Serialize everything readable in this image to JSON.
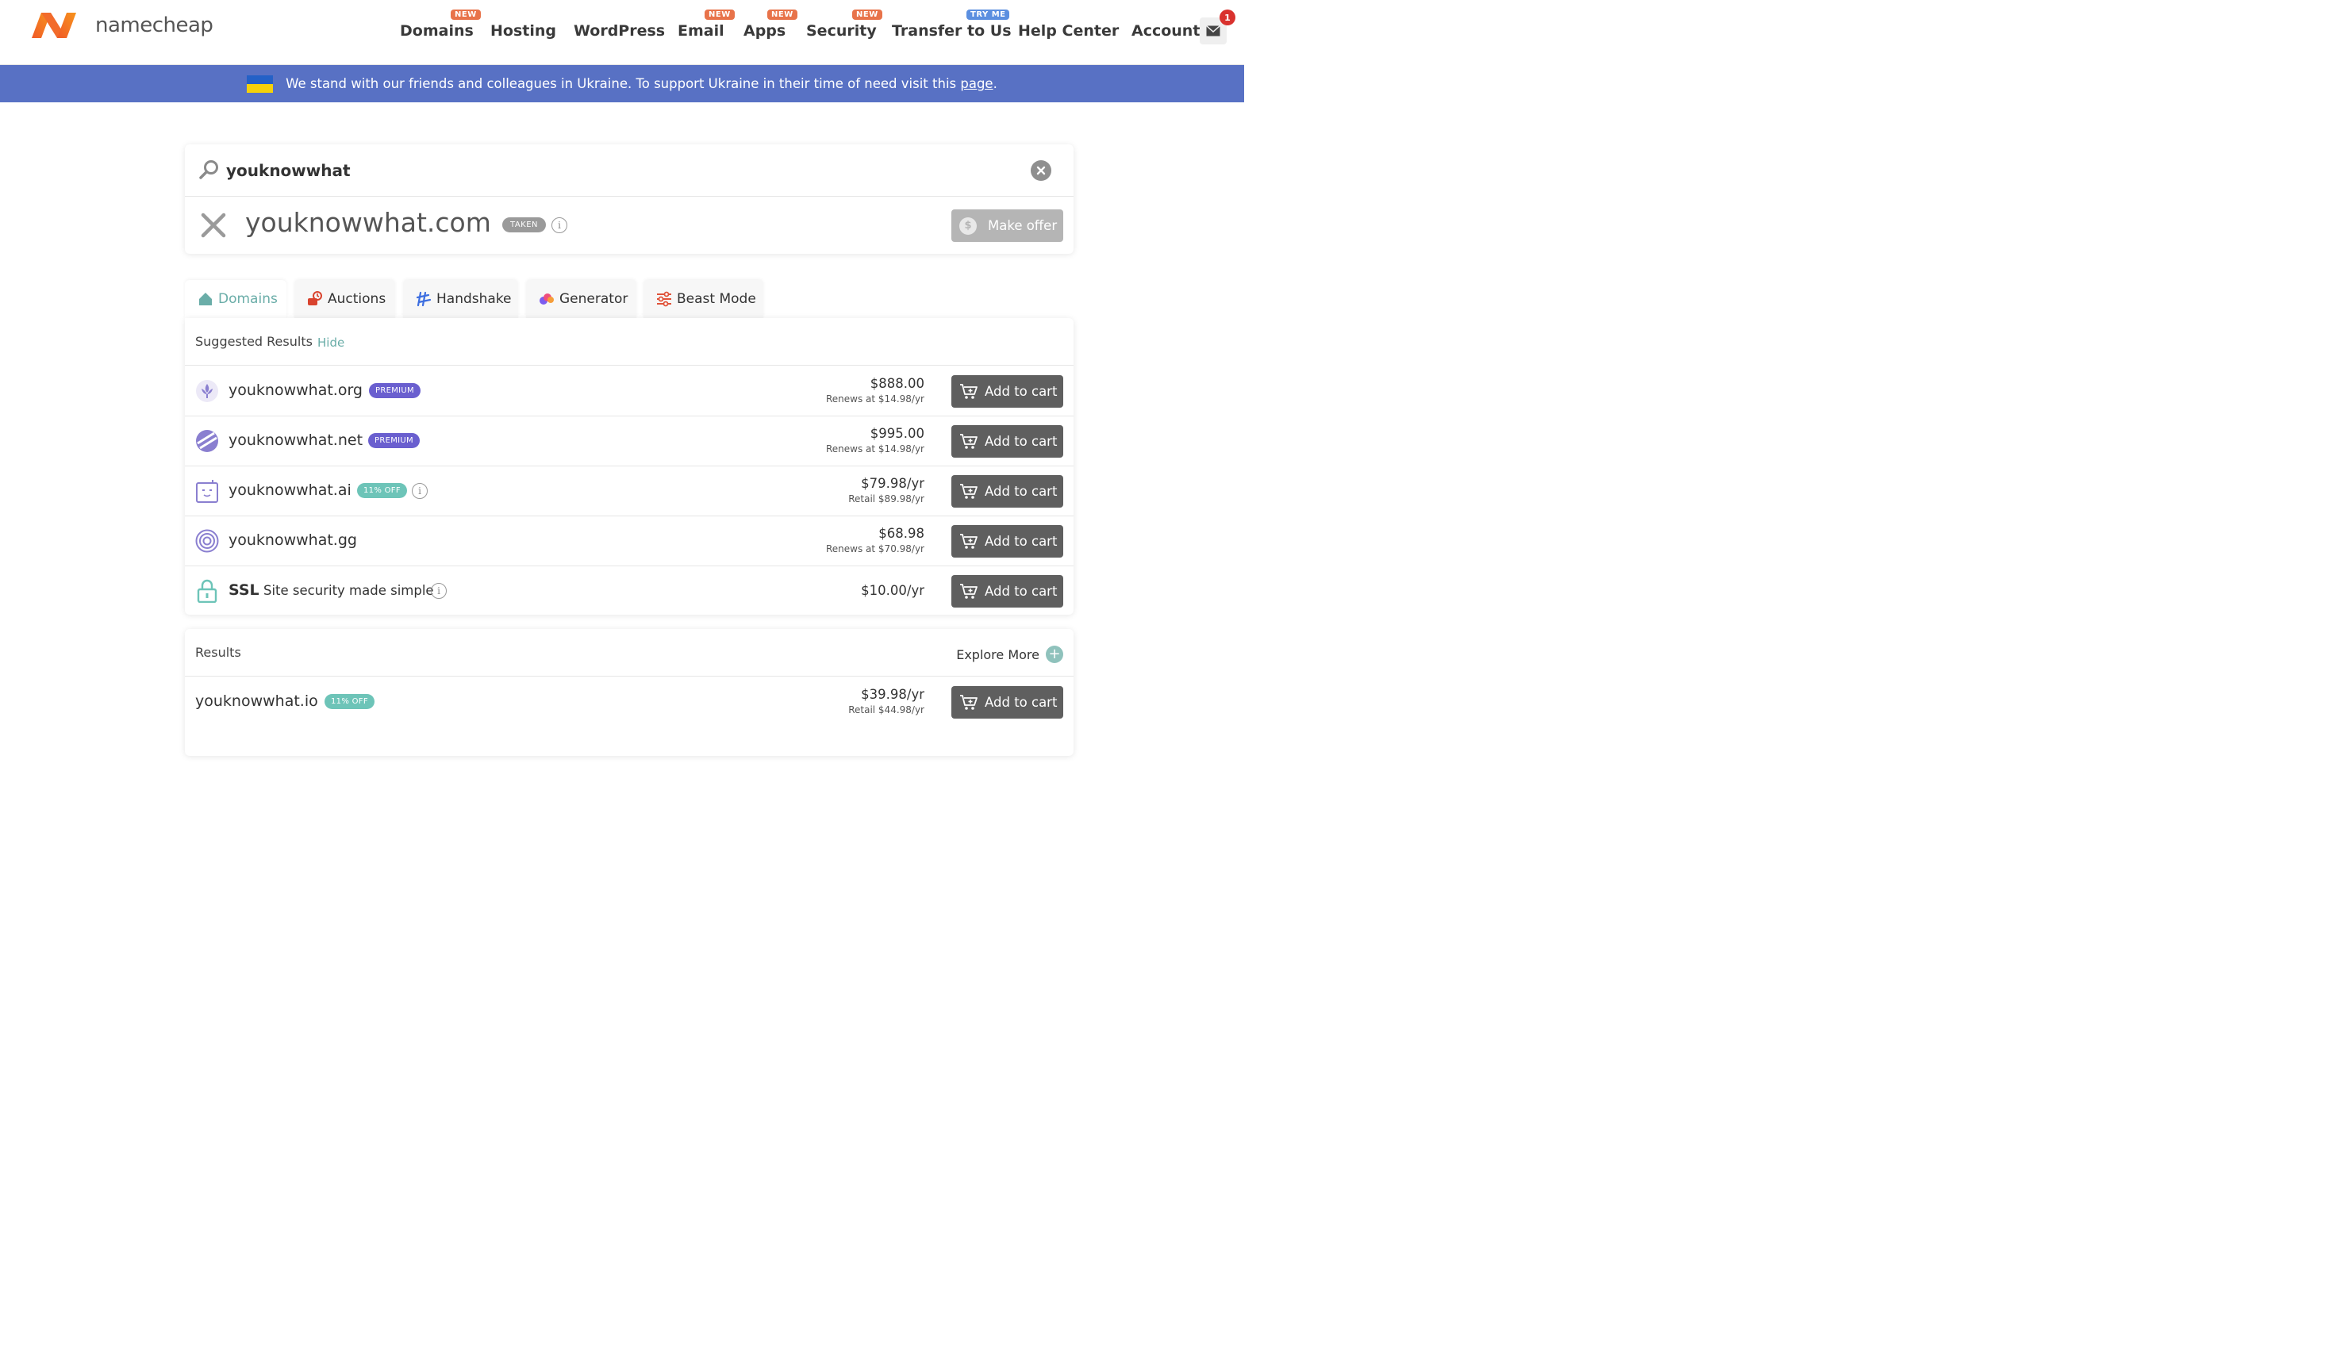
{
  "header": {
    "logo_text": "namecheap",
    "nav": [
      {
        "label": "Domains",
        "badge": "NEW"
      },
      {
        "label": "Hosting",
        "badge": ""
      },
      {
        "label": "WordPress",
        "badge": ""
      },
      {
        "label": "Email",
        "badge": "NEW"
      },
      {
        "label": "Apps",
        "badge": "NEW"
      },
      {
        "label": "Security",
        "badge": "NEW"
      },
      {
        "label": "Transfer to Us",
        "badge": "TRY ME"
      },
      {
        "label": "Help Center",
        "badge": ""
      },
      {
        "label": "Account",
        "badge": ""
      }
    ],
    "mail_count": "1",
    "brand_color": "#e8734a"
  },
  "banner": {
    "text": "We stand with our friends and colleagues in Ukraine. To support Ukraine in their time of need visit this ",
    "link": "page",
    "suffix": ".",
    "color": "#5871c4"
  },
  "search": {
    "value": "youknowwhat",
    "taken_domain": "youknowwhat.com",
    "taken_badge": "TAKEN",
    "offer_label": "Make offer",
    "offer_icon": "$"
  },
  "tabs": [
    {
      "label": "Domains",
      "icon": "home-icon",
      "active": true
    },
    {
      "label": "Auctions",
      "icon": "auction-icon",
      "active": false
    },
    {
      "label": "Handshake",
      "icon": "handshake-icon",
      "active": false
    },
    {
      "label": "Generator",
      "icon": "generator-icon",
      "active": false
    },
    {
      "label": "Beast Mode",
      "icon": "sliders-icon",
      "active": false
    }
  ],
  "suggested": {
    "title": "Suggested Results",
    "hide_label": "Hide",
    "rows": [
      {
        "domain": "youknowwhat.org",
        "badge": "PREMIUM",
        "price": "$888.00",
        "sub": "Renews at $14.98/yr",
        "cart": "Add to cart"
      },
      {
        "domain": "youknowwhat.net",
        "badge": "PREMIUM",
        "price": "$995.00",
        "sub": "Renews at $14.98/yr",
        "cart": "Add to cart"
      },
      {
        "domain": "youknowwhat.ai",
        "badge": "11% OFF",
        "price": "$79.98/yr",
        "sub": "Retail $89.98/yr",
        "cart": "Add to cart"
      },
      {
        "domain": "youknowwhat.gg",
        "badge": "",
        "price": "$68.98",
        "sub": "Renews at $70.98/yr",
        "cart": "Add to cart"
      }
    ],
    "ssl": {
      "name": "SSL",
      "desc": "Site security made simple",
      "price": "$10.00/yr",
      "cart": "Add to cart"
    }
  },
  "results": {
    "title": "Results",
    "explore_label": "Explore More",
    "rows": [
      {
        "domain": "youknowwhat.io",
        "badge": "11% OFF",
        "price": "$39.98/yr",
        "sub": "Retail $44.98/yr",
        "cart": "Add to cart"
      }
    ]
  },
  "colors": {
    "accent": "#6aada8",
    "premium": "#6a5fcf",
    "discount": "#6dc4b8",
    "cart_button": "#5f5f5f"
  }
}
